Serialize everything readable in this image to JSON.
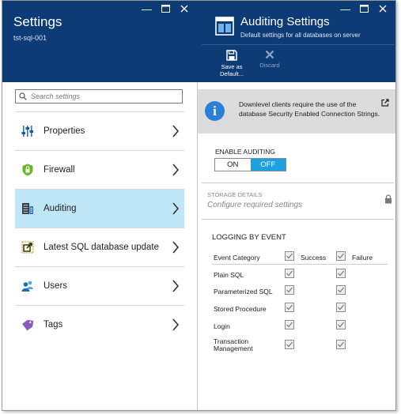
{
  "left_blade": {
    "title": "Settings",
    "subtitle": "tst-sql-001",
    "controls": [
      "minimize-icon",
      "maximize-icon",
      "close-icon"
    ],
    "search": {
      "placeholder": "Search settings",
      "value": ""
    },
    "items": [
      {
        "label": "Properties",
        "icon": "properties-sliders-icon",
        "active": false
      },
      {
        "label": "Firewall",
        "icon": "firewall-shield-icon",
        "active": false
      },
      {
        "label": "Auditing",
        "icon": "auditing-server-icon",
        "active": true
      },
      {
        "label": "Latest SQL database update",
        "icon": "update-icon",
        "active": false
      },
      {
        "label": "Users",
        "icon": "users-icon",
        "active": false
      },
      {
        "label": "Tags",
        "icon": "tag-icon",
        "active": false
      }
    ]
  },
  "right_blade": {
    "title": "Auditing Settings",
    "subtitle": "Default settings for all databases on server",
    "controls": [
      "minimize-icon",
      "maximize-icon",
      "close-icon"
    ],
    "toolbar": {
      "save_label": "Save as Default...",
      "discard_label": "Discard"
    },
    "info": {
      "text": "Downlevel clients require the use of the database Security Enabled Connection Strings.",
      "icon": "info-icon"
    },
    "enable_auditing": {
      "label": "ENABLE AUDITING",
      "on_label": "ON",
      "off_label": "OFF",
      "selected": "OFF"
    },
    "storage": {
      "label": "STORAGE DETAILS",
      "value": "Configure required settings"
    },
    "logging": {
      "title": "LOGGING BY EVENT",
      "header": {
        "category": "Event Category",
        "success": "Success",
        "failure": "Failure"
      },
      "rows": [
        {
          "name": "Plain SQL",
          "success": true,
          "failure": true
        },
        {
          "name": "Parameterized SQL",
          "success": true,
          "failure": true
        },
        {
          "name": "Stored Procedure",
          "success": true,
          "failure": true
        },
        {
          "name": "Login",
          "success": true,
          "failure": true
        },
        {
          "name": "Transaction Management",
          "success": true,
          "failure": true
        }
      ]
    }
  },
  "colors": {
    "header_bg": "#0d3b75",
    "active_item": "#bfe6f6",
    "toggle_selected": "#1ba1e2",
    "info_bg": "#dcdcdc"
  }
}
